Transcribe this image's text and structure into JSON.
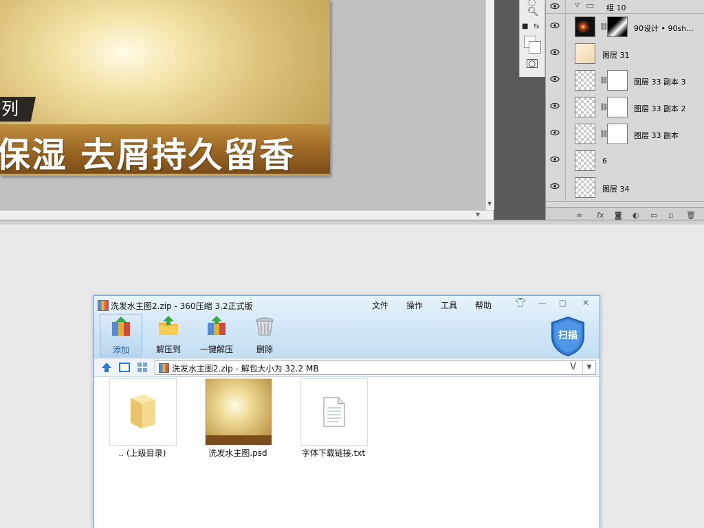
{
  "photoshop": {
    "canvas": {
      "tag_text": "列",
      "slogan": "保湿 去屑持久留香"
    },
    "layers": [
      {
        "name": "组 10",
        "kind": "group"
      },
      {
        "name": "90设计 • 90sh...",
        "kind": "masked"
      },
      {
        "name": "图层 31",
        "kind": "plain"
      },
      {
        "name": "图层 33 副本 3",
        "kind": "masked"
      },
      {
        "name": "图层 33 副本 2",
        "kind": "masked"
      },
      {
        "name": "图层 33 副本",
        "kind": "masked"
      },
      {
        "name": "6",
        "kind": "plain"
      },
      {
        "name": "图层 34",
        "kind": "plain"
      }
    ],
    "layer_footer_icons": [
      "link-icon",
      "fx-icon",
      "mask-icon",
      "adjustment-icon",
      "folder-icon",
      "new-layer-icon",
      "trash-icon"
    ]
  },
  "zip_window": {
    "title": "洗发水主图2.zip - 360压缩 3.2正式版",
    "menu": [
      "文件",
      "操作",
      "工具",
      "帮助"
    ],
    "toolbar": [
      {
        "label": "添加",
        "icon": "add-archive-icon"
      },
      {
        "label": "解压到",
        "icon": "extract-to-icon"
      },
      {
        "label": "一键解压",
        "icon": "one-click-extract-icon"
      },
      {
        "label": "删除",
        "icon": "delete-icon"
      }
    ],
    "scan_label": "扫描",
    "address": "洗发水主图2.zip - 解包大小为 32.2 MB",
    "address_suffix": "V",
    "files": [
      {
        "name": ".. (上级目录)",
        "icon": "folder-icon"
      },
      {
        "name": "洗发水主图.psd",
        "icon": "psd-thumbnail"
      },
      {
        "name": "字体下载链接.txt",
        "icon": "text-file-icon"
      }
    ]
  },
  "colors": {
    "ps_dark": "#5a5a5a",
    "zip_blue": "#cfe5f5",
    "gold": "#9a6624"
  }
}
